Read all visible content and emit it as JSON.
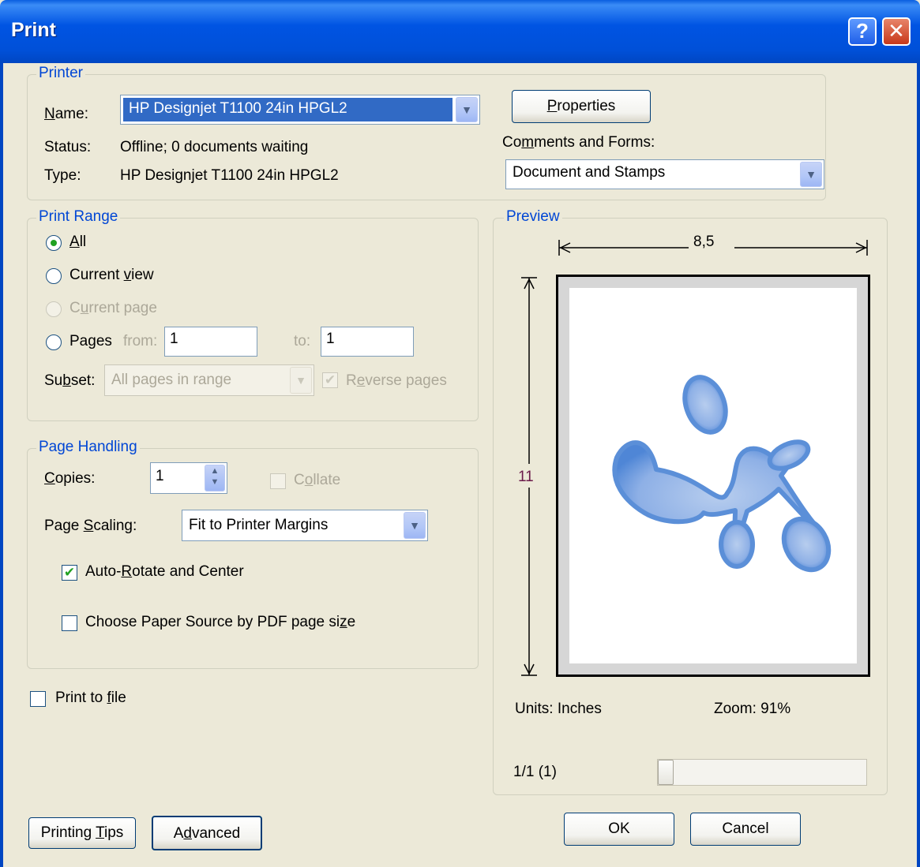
{
  "window": {
    "title": "Print",
    "help_glyph": "?",
    "close_glyph": "✕"
  },
  "printer": {
    "legend": "Printer",
    "name_label": "Name:",
    "name_value": "HP Designjet T1100 24in HPGL2",
    "status_label": "Status:",
    "status_value": "Offline; 0 documents waiting",
    "type_label": "Type:",
    "type_value": "HP Designjet T1100 24in HPGL2",
    "properties_button": "Properties",
    "comments_label": "Comments and Forms:",
    "comments_value": "Document and Stamps"
  },
  "print_range": {
    "legend": "Print Range",
    "all": "All",
    "current_view": "Current view",
    "current_page": "Current page",
    "pages": "Pages",
    "from_label": "from:",
    "from_value": "1",
    "to_label": "to:",
    "to_value": "1",
    "subset_label": "Subset:",
    "subset_value": "All pages in range",
    "reverse_pages": "Reverse pages",
    "selected": "All"
  },
  "page_handling": {
    "legend": "Page Handling",
    "copies_label": "Copies:",
    "copies_value": "1",
    "collate": "Collate",
    "scaling_label": "Page Scaling:",
    "scaling_value": "Fit to Printer Margins",
    "auto_rotate": "Auto-Rotate and Center",
    "auto_rotate_checked": true,
    "paper_source": "Choose Paper Source by PDF page size",
    "paper_source_checked": false
  },
  "print_to_file": {
    "label": "Print to file",
    "checked": false
  },
  "preview": {
    "legend": "Preview",
    "width_label": "8,5",
    "height_label": "11",
    "units": "Units: Inches",
    "zoom": "Zoom:  91%",
    "page_indicator": "1/1 (1)",
    "slider_position": 0
  },
  "buttons": {
    "printing_tips": "Printing Tips",
    "advanced": "Advanced",
    "ok": "OK",
    "cancel": "Cancel"
  }
}
